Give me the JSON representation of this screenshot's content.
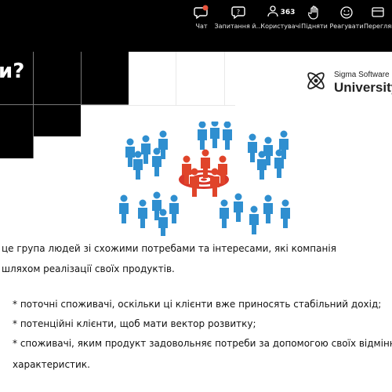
{
  "toolbar": {
    "items": [
      {
        "label": "Чат",
        "icon": "chat-icon"
      },
      {
        "label": "Запитання й…",
        "icon": "question-icon"
      },
      {
        "label": "Користувачі",
        "icon": "people-icon",
        "count": "363"
      },
      {
        "label": "Підняти",
        "icon": "raise-hand-icon"
      },
      {
        "label": "Реагувати",
        "icon": "smile-icon"
      },
      {
        "label": "Перегляну",
        "icon": "view-icon"
      }
    ],
    "badge_color": "#e8543d"
  },
  "slide": {
    "title": "и?",
    "logo": {
      "small": "Sigma Software",
      "big": "University"
    },
    "lines": [
      "це група людей зі схожими потребами та інтересами, які компанія",
      "шляхом реалізації своїх продуктів.",
      "* поточні споживачі, оскільки ці клієнти вже приносять стабільний дохід;",
      "* потенційні клієнти, щоб мати вектор розвитку;",
      "* споживачі, яким продукт задовольняє потреби за допомогою своїх відмінних",
      "характеристик."
    ],
    "colors": {
      "people": "#2f8fd0",
      "target_group": "#e0442a",
      "target": "#d9372a"
    }
  }
}
